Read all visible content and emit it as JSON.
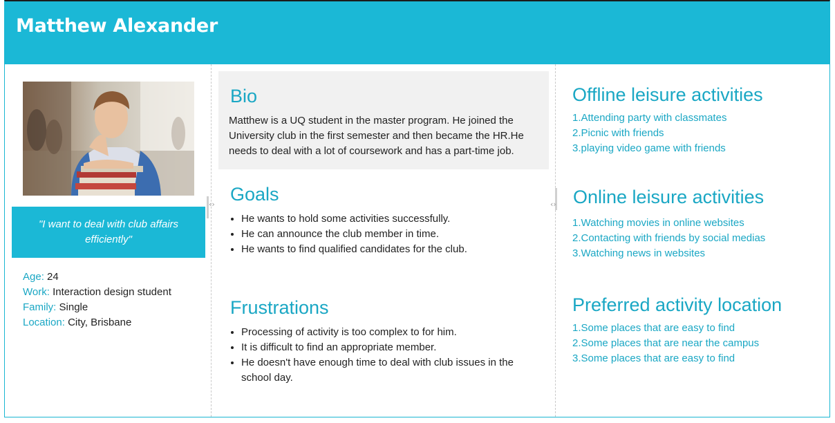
{
  "persona": {
    "name": "Matthew Alexander"
  },
  "left": {
    "quote": "\"I want to deal with club affairs efficiently\"",
    "facts": [
      {
        "label": "Age:",
        "value": "24"
      },
      {
        "label": "Work:",
        "value": "Interaction design student"
      },
      {
        "label": "Family:",
        "value": "Single"
      },
      {
        "label": "Location:",
        "value": "City, Brisbane"
      }
    ]
  },
  "middle": {
    "bio": {
      "title": "Bio",
      "text": "Matthew is a UQ student in the master program. He joined the University club in the first semester and then became the HR.He needs to deal with a lot of coursework and has a part-time job."
    },
    "goals": {
      "title": "Goals",
      "items": [
        "He wants to hold some activities successfully.",
        "He can announce the club member in time.",
        "He wants to find qualified candidates for the club."
      ]
    },
    "frustrations": {
      "title": "Frustrations",
      "items": [
        "Processing of activity is too complex to for him.",
        "It is difficult to find an appropriate member.",
        "He doesn't have enough time to deal with club issues in the school day."
      ]
    }
  },
  "right": {
    "offline": {
      "title": "Offline leisure activities",
      "items": [
        "1.Attending party with classmates",
        "2.Picnic with friends",
        "3.playing video game with friends"
      ]
    },
    "online": {
      "title": "Online leisure activities",
      "items": [
        "1.Watching movies in online websites",
        "2.Contacting with friends by social medias",
        "3.Watching news in websites"
      ]
    },
    "location": {
      "title": "Preferred activity location",
      "items": [
        "1.Some places that are easy to find",
        "2.Some places that are near the campus",
        "3.Some places that are easy to find"
      ]
    }
  },
  "ui": {
    "resize_arrows": "‹›",
    "accent_color": "#1bb8d6"
  }
}
